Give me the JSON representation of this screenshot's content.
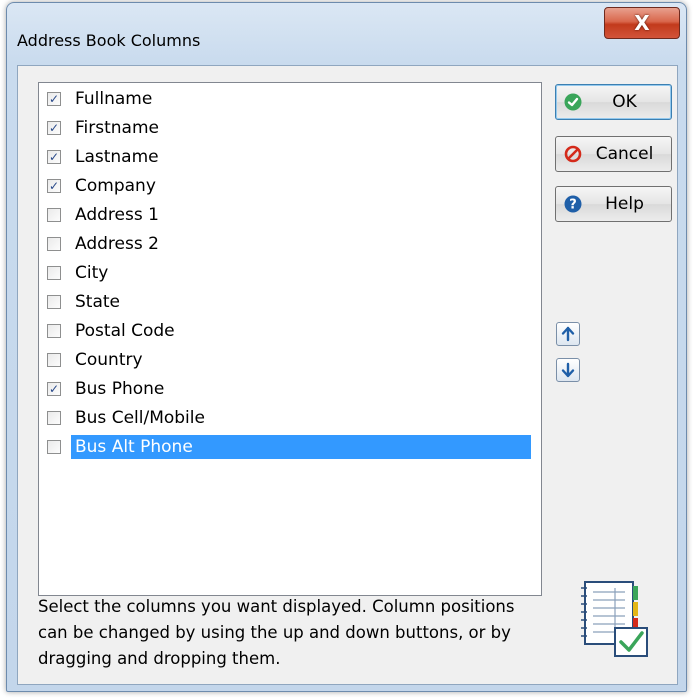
{
  "window": {
    "title": "Address Book Columns",
    "close_glyph": "X"
  },
  "columns": [
    {
      "label": "Fullname",
      "checked": true
    },
    {
      "label": "Firstname",
      "checked": true
    },
    {
      "label": "Lastname",
      "checked": true
    },
    {
      "label": "Company",
      "checked": true
    },
    {
      "label": "Address 1",
      "checked": false
    },
    {
      "label": "Address 2",
      "checked": false
    },
    {
      "label": "City",
      "checked": false
    },
    {
      "label": "State",
      "checked": false
    },
    {
      "label": "Postal Code",
      "checked": false
    },
    {
      "label": "Country",
      "checked": false
    },
    {
      "label": "Bus Phone",
      "checked": true
    },
    {
      "label": "Bus Cell/Mobile",
      "checked": false
    },
    {
      "label": "Bus Alt Phone",
      "checked": false,
      "selected": true
    }
  ],
  "buttons": {
    "ok": {
      "label": "OK",
      "icon": "check-circle-icon"
    },
    "cancel": {
      "label": "Cancel",
      "icon": "no-entry-icon"
    },
    "help": {
      "label": "Help",
      "icon": "question-circle-icon"
    },
    "move_up": {
      "icon": "arrow-up-icon"
    },
    "move_down": {
      "icon": "arrow-down-icon"
    }
  },
  "instructions": "Select the columns you want displayed. Column positions can be changed by using the up and down buttons, or by dragging and dropping them.",
  "colors": {
    "selection": "#3399ff",
    "close_button": "#c7432a",
    "ok_icon": "#3aa55a",
    "cancel_icon": "#d42a1a",
    "help_icon": "#1f5fa8"
  }
}
